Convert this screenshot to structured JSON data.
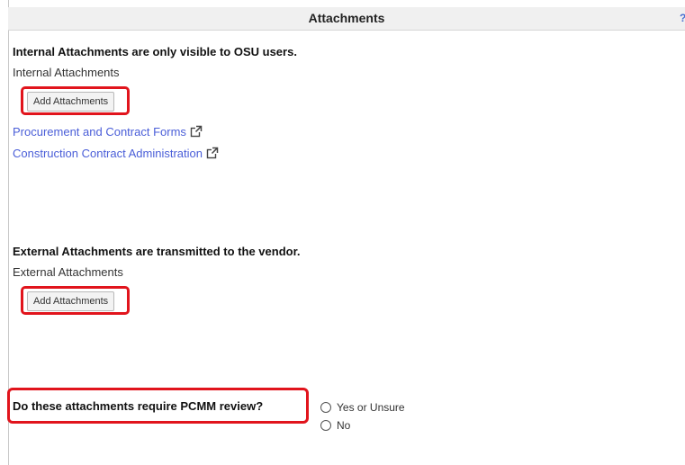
{
  "header": {
    "title": "Attachments",
    "help_label": "?"
  },
  "internal": {
    "heading": "Internal Attachments are only visible to OSU users.",
    "label": "Internal Attachments",
    "button_label": "Add Attachments",
    "links": [
      {
        "label": "Procurement and Contract Forms",
        "icon": "external-link-icon"
      },
      {
        "label": "Construction Contract Administration",
        "icon": "external-link-icon"
      }
    ]
  },
  "external": {
    "heading": "External Attachments are transmitted to the vendor.",
    "label": "External Attachments",
    "button_label": "Add Attachments"
  },
  "review": {
    "question": "Do these attachments require PCMM review?",
    "options": [
      "Yes or Unsure",
      "No"
    ]
  },
  "colors": {
    "highlight": "#e1141c",
    "link": "#4a5ed8",
    "header_bg": "#f0f0f0"
  }
}
